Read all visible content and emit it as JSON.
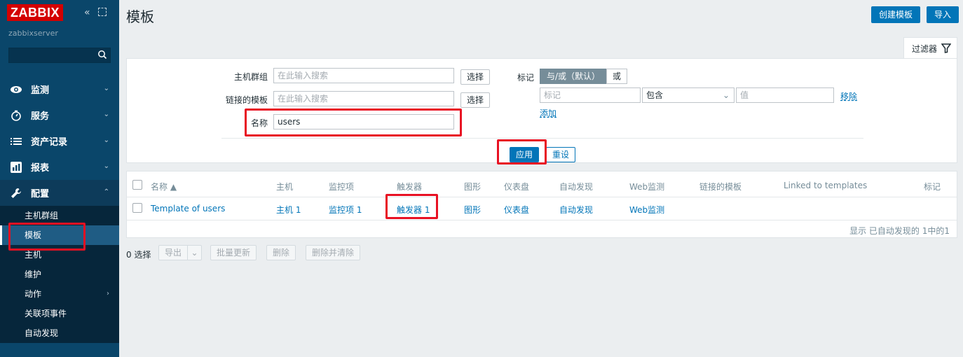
{
  "sidebar": {
    "logo": "ZABBIX",
    "collapse": "«",
    "server": "zabbixserver",
    "menu": [
      {
        "label": "监测",
        "icon": "eye-icon"
      },
      {
        "label": "服务",
        "icon": "clock-icon"
      },
      {
        "label": "资产记录",
        "icon": "list-icon"
      },
      {
        "label": "报表",
        "icon": "chart-icon"
      },
      {
        "label": "配置",
        "icon": "wrench-icon"
      }
    ],
    "submenu": [
      "主机群组",
      "模板",
      "主机",
      "维护",
      "动作",
      "关联项事件",
      "自动发现"
    ]
  },
  "header": {
    "title": "模板",
    "create_label": "创建模板",
    "import_label": "导入"
  },
  "filter": {
    "tab_label": "过滤器",
    "host_group_label": "主机群组",
    "host_group_placeholder": "在此输入搜索",
    "linked_label": "链接的模板",
    "linked_placeholder": "在此输入搜索",
    "select_label": "选择",
    "name_label": "名称",
    "name_value": "users",
    "tag_label": "标记",
    "and_or": "与/或（默认）",
    "or": "或",
    "tag_placeholder": "标记",
    "operator": "包含",
    "value_placeholder": "值",
    "remove": "移除",
    "add": "添加",
    "apply": "应用",
    "reset": "重设"
  },
  "table": {
    "headers": [
      "名称 ▲",
      "主机",
      "监控项",
      "触发器",
      "图形",
      "仪表盘",
      "自动发现",
      "Web监测",
      "链接的模板",
      "Linked to templates",
      "标记"
    ],
    "rows": [
      [
        "Template of users",
        "主机 1",
        "监控项 1",
        "触发器 1",
        "图形",
        "仪表盘",
        "自动发现",
        "Web监测",
        "",
        "",
        ""
      ]
    ],
    "footer": "显示 已自动发现的 1中的1"
  },
  "actions": {
    "selected": "0 选择",
    "export": "导出",
    "mass_update": "批量更新",
    "delete": "删除",
    "delete_clear": "删除并清除"
  },
  "colors": {
    "sidebar_bg": "#0a466a",
    "accent": "#0275b8",
    "highlight": "#e81123"
  }
}
